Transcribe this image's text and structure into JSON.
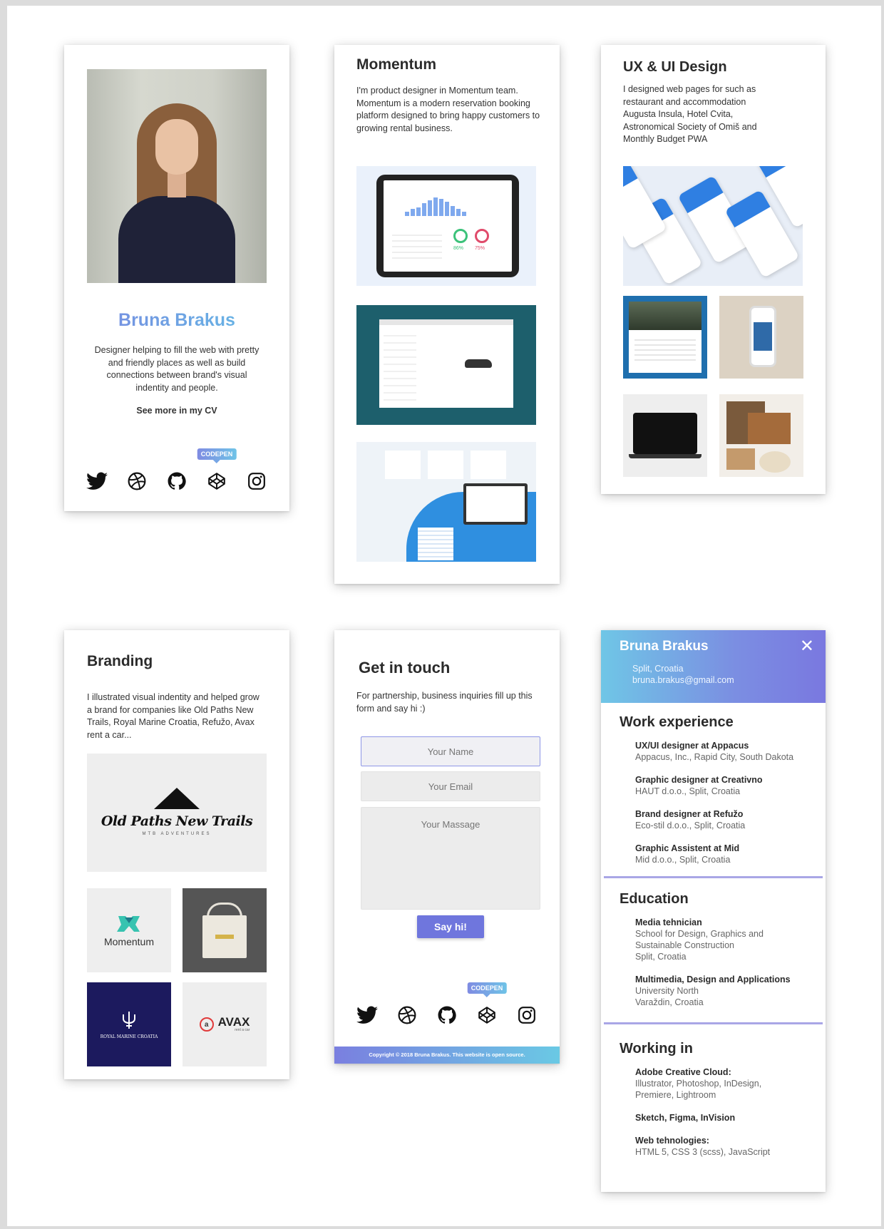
{
  "profile": {
    "name": "Bruna Brakus",
    "description": "Designer helping to fill the web with pretty and friendly places as well as build connections between brand's visual indentity and people.",
    "cv_link": "See more in my CV",
    "tooltip": "CODEPEN"
  },
  "momentum": {
    "title": "Momentum",
    "description": "I'm product designer in Momentum team. Momentum is a modern reservation booking platform designed to bring happy customers to growing rental business.",
    "dashboard_rings": [
      "86%",
      "75%"
    ]
  },
  "ux": {
    "title": "UX & UI Design",
    "description": "I designed web pages for  such as restaurant and accommodation Augusta Insula, Hotel Cvita, Astronomical Society of Omiš and Monthly Budget PWA"
  },
  "branding": {
    "title": "Branding",
    "description": "I illustrated visual indentity and helped grow a brand for companies like Old Paths New Trails, Royal Marine Croatia, Refužo, Avax rent a car...",
    "logo_old_paths": "Old Paths New Trails",
    "logo_old_paths_sub": "MTB ADVENTURES",
    "logo_momentum": "Momentum",
    "logo_royal_marine": "ROYAL MARINE CROATIA",
    "logo_avax": "AVAX",
    "logo_avax_sub": "rent a car",
    "logo_avax_badge": "a"
  },
  "contact": {
    "title": "Get in touch",
    "description": "For partnership, business inquiries fill up this form and say hi :)",
    "name_placeholder": "Your Name",
    "email_placeholder": "Your Email",
    "message_placeholder": "Your Massage",
    "submit_label": "Say hi!",
    "tooltip": "CODEPEN",
    "footer": "Copyright © 2018 Bruna Brakus. This website is open source."
  },
  "cv": {
    "name": "Bruna Brakus",
    "close": "✕",
    "location": "Split, Croatia",
    "email": "bruna.brakus@gmail.com",
    "work_title": "Work experience",
    "work": [
      {
        "role": "UX/UI designer at Appacus",
        "place": "Appacus, Inc., Rapid City, South Dakota"
      },
      {
        "role": "Graphic designer at Creativno",
        "place": "HAUT d.o.o., Split, Croatia"
      },
      {
        "role": "Brand designer at Refužo",
        "place": "Eco-stil d.o.o., Split, Croatia"
      },
      {
        "role": "Graphic Assistent at Mid",
        "place": "Mid d.o.o., Split, Croatia"
      }
    ],
    "education_title": "Education",
    "education": [
      {
        "degree": "Media tehnician",
        "school": "School for Design, Graphics and Sustainable Construction",
        "city": "Split, Croatia"
      },
      {
        "degree": "Multimedia, Design and Applications",
        "school": "University North",
        "city": "Varaždin, Croatia"
      }
    ],
    "working_title": "Working in",
    "tools": [
      {
        "name": "Adobe Creative Cloud:",
        "detail": "Illustrator, Photoshop, InDesign, Premiere, Lightroom"
      },
      {
        "name": "Sketch, Figma, InVision",
        "detail": ""
      },
      {
        "name": "Web tehnologies:",
        "detail": "HTML 5, CSS 3 (scss), JavaScript"
      }
    ]
  },
  "social_icons": [
    "twitter-icon",
    "dribbble-icon",
    "github-icon",
    "codepen-icon",
    "instagram-icon"
  ],
  "colors": {
    "accent_purple": "#6f76dd",
    "accent_blue": "#6ac9e4",
    "name_gradient_start": "#7a86e0",
    "name_gradient_end": "#62bfe6"
  }
}
